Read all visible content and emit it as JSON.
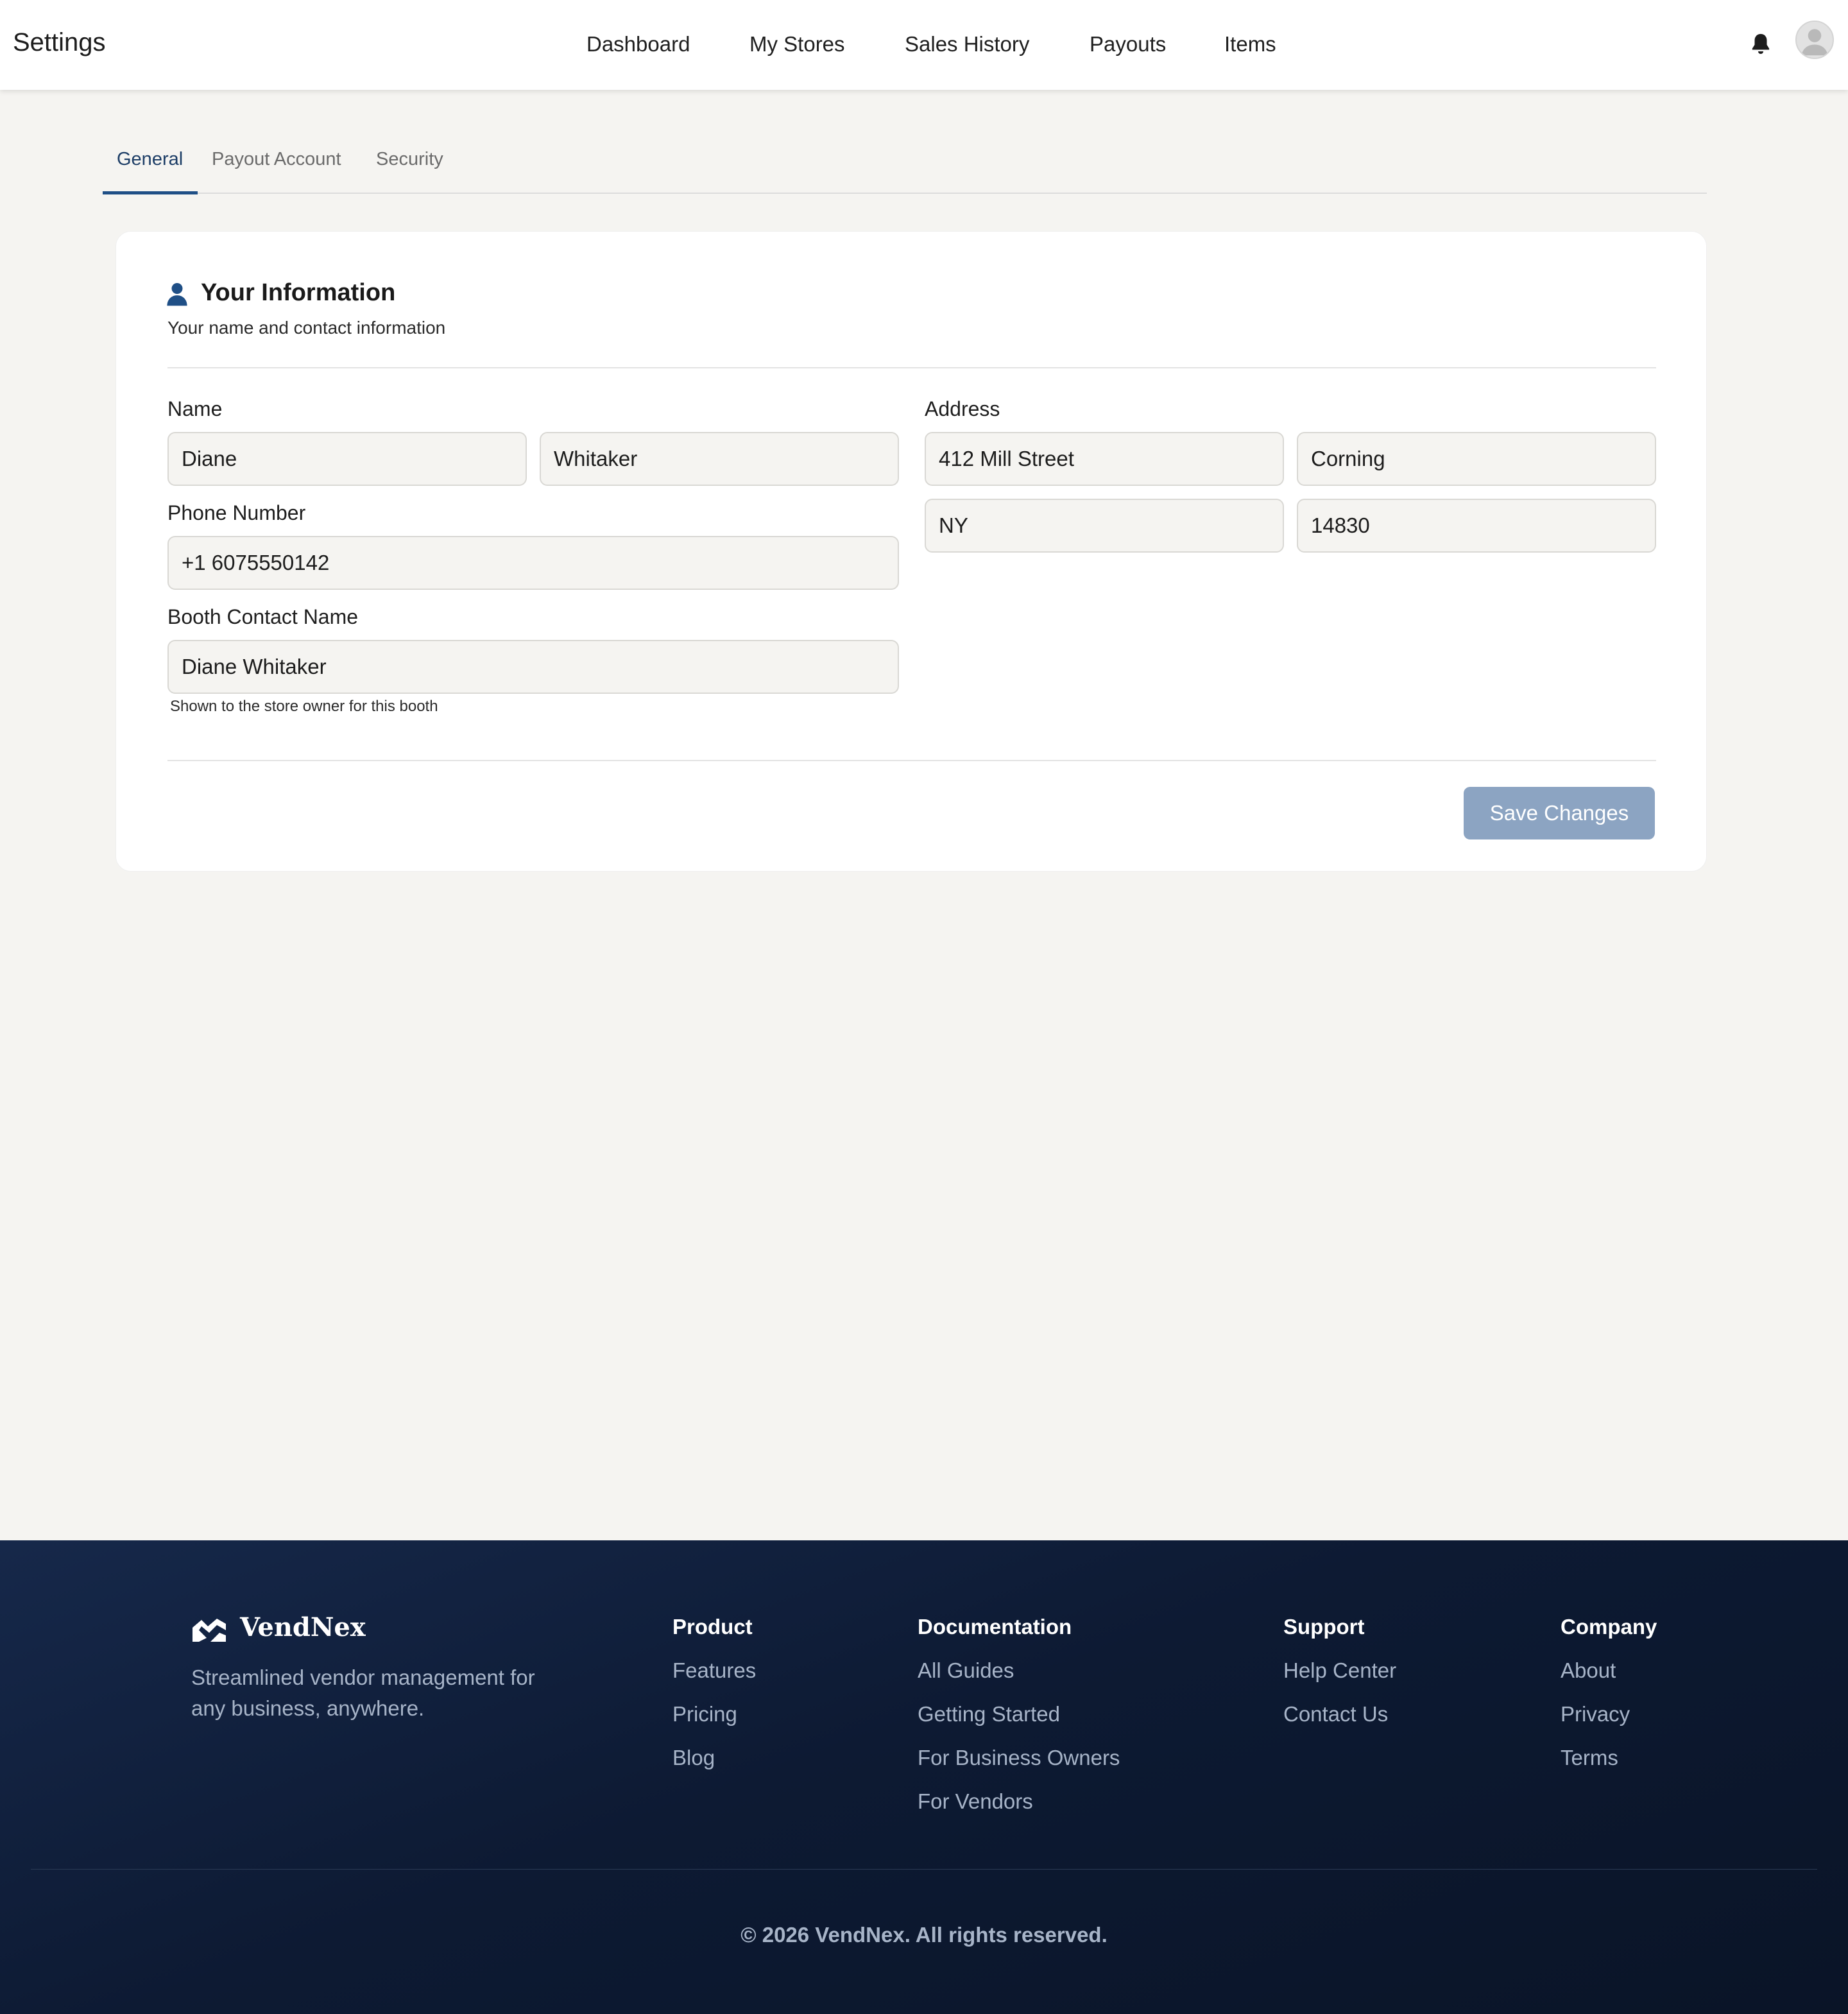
{
  "header": {
    "title": "Settings",
    "nav": [
      "Dashboard",
      "My Stores",
      "Sales History",
      "Payouts",
      "Items"
    ]
  },
  "tabs": [
    "General",
    "Payout Account",
    "Security"
  ],
  "active_tab": "General",
  "card": {
    "title": "Your Information",
    "subtitle": "Your name and contact information",
    "name_label": "Name",
    "first_name": "Diane",
    "last_name": "Whitaker",
    "phone_label": "Phone Number",
    "phone": "+1 6075550142",
    "booth_label": "Booth Contact Name",
    "booth_contact": "Diane Whitaker",
    "booth_hint": "Shown to the store owner for this booth",
    "address_label": "Address",
    "street": "412 Mill Street",
    "city": "Corning",
    "state": "NY",
    "zip": "14830",
    "save_label": "Save Changes"
  },
  "footer": {
    "brand": "VendNex",
    "tagline": "Streamlined vendor management for any business, anywhere.",
    "columns": [
      {
        "title": "Product",
        "links": [
          "Features",
          "Pricing",
          "Blog"
        ]
      },
      {
        "title": "Documentation",
        "links": [
          "All Guides",
          "Getting Started",
          "For Business Owners",
          "For Vendors"
        ]
      },
      {
        "title": "Support",
        "links": [
          "Help Center",
          "Contact Us"
        ]
      },
      {
        "title": "Company",
        "links": [
          "About",
          "Privacy",
          "Terms"
        ]
      }
    ],
    "copyright": "© 2026 VendNex. All rights reserved."
  },
  "colors": {
    "accent": "#1f4f86",
    "save_button": "#8ca4c2",
    "footer_bg": "#0d1a33",
    "page_bg": "#f5f4f1"
  },
  "icons": [
    "bell-icon",
    "avatar-icon",
    "user-icon",
    "vendnex-logo-icon"
  ]
}
